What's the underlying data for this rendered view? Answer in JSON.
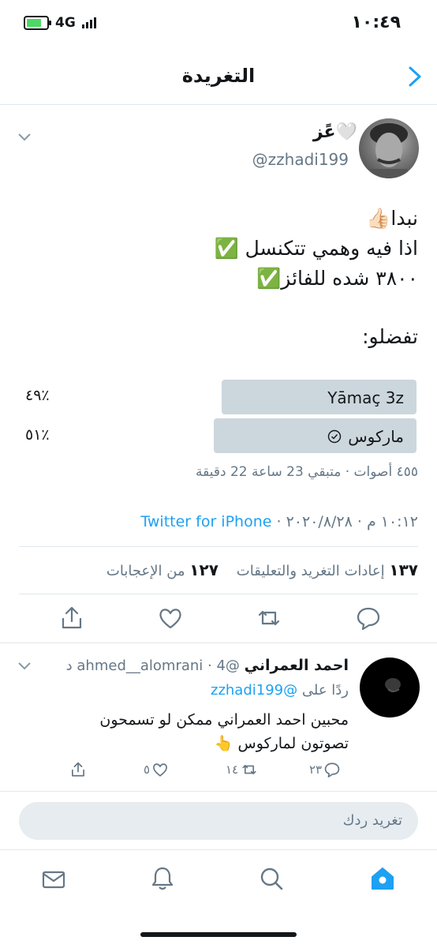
{
  "status_bar": {
    "time": "١٠:٤٩",
    "network": "4G",
    "battery_level": 0.75
  },
  "header": {
    "title": "التغريدة"
  },
  "tweet": {
    "author_name": "عًز🤍",
    "author_handle": "@zzhadi199",
    "text": "نبدا👍🏻\nاذا فيه وهمي تتكنسل ✅\n٣٨٠٠ شده للفائز✅",
    "prompt": "تفضلو:",
    "poll": {
      "options": [
        {
          "label": "Yāmaç 3z",
          "percent_label": "٤٩٪",
          "fraction": 0.49
        },
        {
          "label": "ماركوس",
          "percent_label": "٥١٪",
          "fraction": 0.51,
          "selected_icon": "check-circle-icon"
        }
      ],
      "meta": "٤٥٥ أصوات · متبقي 23 ساعة 22 دقيقة"
    },
    "timestamp": "١٠:١٢ م · ٢٠٢٠/٨/٢٨ ·",
    "source": "Twitter for iPhone",
    "stats": {
      "retweets_count": "١٣٧",
      "retweets_label": "إعادات التغريد والتعليقات",
      "likes_count": "١٢٧",
      "likes_label": "من الإعجابات"
    }
  },
  "reply": {
    "author_name": "احمد العمراني",
    "author_handle": "@ahmed__alomrani",
    "time_ago": "· 4 د",
    "replying_to_label": "ردًا على",
    "replying_to_handle": "@zzhadi199",
    "text": "محبين احمد العمراني ممكن لو تسمحون\nتصوتون لماركوس 👆",
    "replies": "٢٣",
    "retweets": "١٤",
    "likes": "٥"
  },
  "compose": {
    "placeholder": "تغريد ردك"
  },
  "colors": {
    "accent": "#1da1f2",
    "muted": "#657786",
    "poll_bar": "#ccd6dd",
    "divider": "#e1e8ed"
  }
}
